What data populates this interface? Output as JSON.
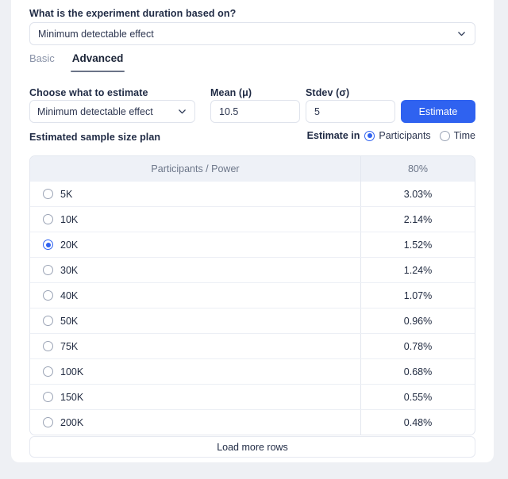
{
  "question": {
    "label": "What is the experiment duration based on?",
    "select_value": "Minimum detectable effect"
  },
  "tabs": [
    {
      "label": "Basic",
      "active": false
    },
    {
      "label": "Advanced",
      "active": true
    }
  ],
  "form": {
    "estimate_label": "Choose what to estimate",
    "estimate_value": "Minimum detectable effect",
    "mean_label": "Mean (μ)",
    "mean_value": "10.5",
    "stdev_label": "Stdev (σ)",
    "stdev_value": "5",
    "estimate_button": "Estimate"
  },
  "plan": {
    "label": "Estimated sample size plan",
    "estimate_in_label": "Estimate in",
    "options": [
      {
        "label": "Participants",
        "selected": true
      },
      {
        "label": "Time",
        "selected": false
      }
    ]
  },
  "table": {
    "columns": [
      "Participants / Power",
      "80%"
    ],
    "rows": [
      {
        "participants": "5K",
        "power": "3.03%",
        "selected": false
      },
      {
        "participants": "10K",
        "power": "2.14%",
        "selected": false
      },
      {
        "participants": "20K",
        "power": "1.52%",
        "selected": true
      },
      {
        "participants": "30K",
        "power": "1.24%",
        "selected": false
      },
      {
        "participants": "40K",
        "power": "1.07%",
        "selected": false
      },
      {
        "participants": "50K",
        "power": "0.96%",
        "selected": false
      },
      {
        "participants": "75K",
        "power": "0.78%",
        "selected": false
      },
      {
        "participants": "100K",
        "power": "0.68%",
        "selected": false
      },
      {
        "participants": "150K",
        "power": "0.55%",
        "selected": false
      },
      {
        "participants": "200K",
        "power": "0.48%",
        "selected": false
      }
    ]
  },
  "load_more_label": "Load more rows",
  "colors": {
    "accent": "#2f62f0",
    "page_bg": "#eef0f4",
    "card_bg": "#ffffff",
    "table_header_bg": "#eef1f7",
    "border": "#e3e7ef",
    "text": "#1f2a44",
    "muted_text": "#6c7689"
  }
}
